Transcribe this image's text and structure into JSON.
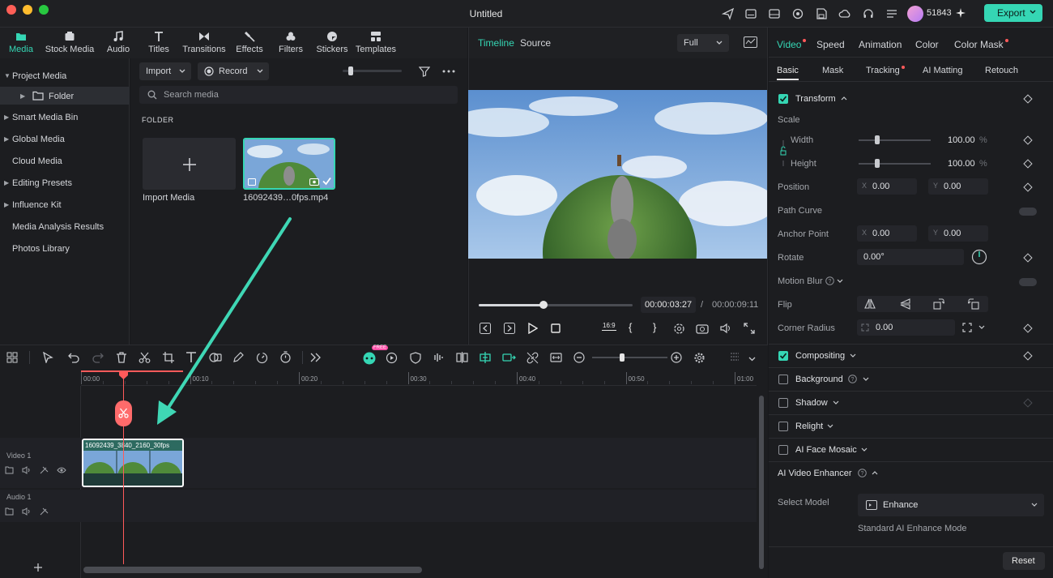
{
  "window": {
    "title": "Untitled",
    "credits": "51843",
    "export_label": "Export"
  },
  "media_tabs": [
    {
      "label": "Media",
      "icon": "media-folder-icon",
      "active": true
    },
    {
      "label": "Stock Media",
      "icon": "stock-media-icon"
    },
    {
      "label": "Audio",
      "icon": "music-note-icon"
    },
    {
      "label": "Titles",
      "icon": "titles-T-icon"
    },
    {
      "label": "Transitions",
      "icon": "transitions-bowtie-icon"
    },
    {
      "label": "Effects",
      "icon": "effects-sparkle-icon"
    },
    {
      "label": "Filters",
      "icon": "filters-circles-icon"
    },
    {
      "label": "Stickers",
      "icon": "stickers-icon"
    },
    {
      "label": "Templates",
      "icon": "templates-grid-icon"
    }
  ],
  "left_nav": [
    {
      "label": "Project Media",
      "caret": "expanded"
    },
    {
      "label": "Folder",
      "caret": "collapsed",
      "selected": true,
      "indent": true
    },
    {
      "label": "Smart Media Bin",
      "caret": "collapsed"
    },
    {
      "label": "Global Media",
      "caret": "collapsed"
    },
    {
      "label": "Cloud Media"
    },
    {
      "label": "Editing Presets",
      "caret": "collapsed"
    },
    {
      "label": "Influence Kit",
      "caret": "collapsed"
    },
    {
      "label": "Media Analysis Results"
    },
    {
      "label": "Photos Library"
    }
  ],
  "browser": {
    "import_label": "Import",
    "record_label": "Record",
    "search_placeholder": "Search media",
    "folder_heading": "FOLDER",
    "import_tile_label": "Import Media",
    "clip_name": "16092439…0fps.mp4"
  },
  "viewer": {
    "tab_timeline": "Timeline",
    "tab_source": "Source",
    "quality": "Full",
    "current_time": "00:00:03:27",
    "separator": "/",
    "total_time": "00:00:09:11",
    "progress": 0.42,
    "aspect_label": "16:9"
  },
  "timeline": {
    "ruler": [
      "00:00",
      "00:10",
      "00:20",
      "00:30",
      "00:40",
      "00:50",
      "01:00"
    ],
    "free_badge": "FREE",
    "tracks": [
      {
        "label": "Video 1"
      },
      {
        "label": "Audio 1"
      }
    ],
    "clip_title": "16092439_3840_2160_30fps"
  },
  "props": {
    "top_tabs": [
      {
        "label": "Video",
        "dot": true,
        "active": true
      },
      {
        "label": "Speed"
      },
      {
        "label": "Animation"
      },
      {
        "label": "Color"
      },
      {
        "label": "Color Mask",
        "dot": true
      }
    ],
    "sub_tabs": [
      {
        "label": "Basic",
        "active": true
      },
      {
        "label": "Mask"
      },
      {
        "label": "Tracking",
        "dot": true
      },
      {
        "label": "AI Matting"
      },
      {
        "label": "Retouch"
      }
    ],
    "transform": "Transform",
    "scale": "Scale",
    "width_label": "Width",
    "width_value": "100.00",
    "height_label": "Height",
    "height_value": "100.00",
    "percent": "%",
    "position": "Position",
    "pos_x": "0.00",
    "pos_y": "0.00",
    "x_label": "X",
    "y_label": "Y",
    "path_curve": "Path Curve",
    "anchor_point": "Anchor Point",
    "anchor_x": "0.00",
    "anchor_y": "0.00",
    "rotate": "Rotate",
    "rotate_value": "0.00°",
    "motion_blur": "Motion Blur",
    "flip": "Flip",
    "corner_radius": "Corner Radius",
    "corner_value": "0.00",
    "compositing": "Compositing",
    "background": "Background",
    "shadow": "Shadow",
    "relight": "Relight",
    "ai_face_mosaic": "AI Face Mosaic",
    "ai_video_enhancer": "AI Video Enhancer",
    "select_model": "Select Model",
    "model_value": "Enhance",
    "model_desc": "Standard AI Enhance Mode",
    "reset": "Reset"
  },
  "colors": {
    "accent": "#35d6b4",
    "playhead": "#ff5a5a",
    "panel": "#1c1d20"
  }
}
